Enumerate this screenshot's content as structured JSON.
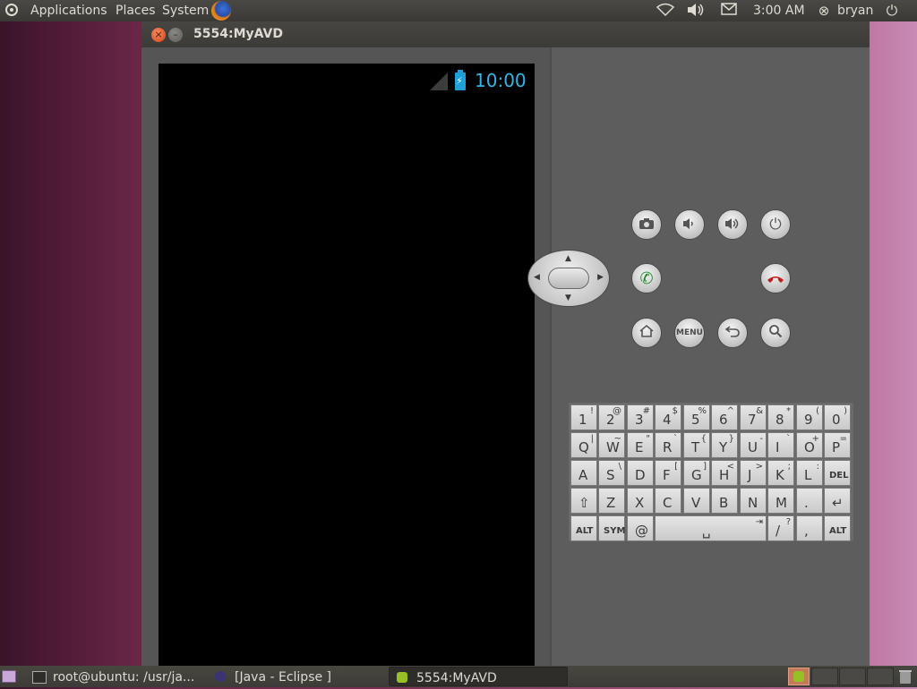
{
  "top_panel": {
    "menus": [
      "Applications",
      "Places",
      "System"
    ],
    "time": "3:00 AM",
    "user": "bryan"
  },
  "window": {
    "title": "5554:MyAVD"
  },
  "phone": {
    "clock": "10:00"
  },
  "controls": {
    "menu_label": "MENU"
  },
  "keyboard": {
    "rows": [
      [
        [
          "1",
          "!"
        ],
        [
          "2",
          "@"
        ],
        [
          "3",
          "#"
        ],
        [
          "4",
          "$"
        ],
        [
          "5",
          "%"
        ],
        [
          "6",
          "^"
        ],
        [
          "7",
          "&"
        ],
        [
          "8",
          "*"
        ],
        [
          "9",
          "("
        ],
        [
          "0",
          ")"
        ]
      ],
      [
        [
          "Q",
          "|"
        ],
        [
          "W",
          "~"
        ],
        [
          "E",
          "\""
        ],
        [
          "R",
          "`"
        ],
        [
          "T",
          "{"
        ],
        [
          "Y",
          "}"
        ],
        [
          "U",
          "-"
        ],
        [
          "I",
          "`"
        ],
        [
          "O",
          "+"
        ],
        [
          "P",
          "="
        ]
      ],
      [
        [
          "A",
          ""
        ],
        [
          "S",
          "\\"
        ],
        [
          "D",
          ""
        ],
        [
          "F",
          "["
        ],
        [
          "G",
          "]"
        ],
        [
          "H",
          "<"
        ],
        [
          "J",
          ">"
        ],
        [
          "K",
          ";"
        ],
        [
          "L",
          ":"
        ],
        [
          "DEL",
          ""
        ]
      ],
      [
        [
          "⇧",
          ""
        ],
        [
          "Z",
          ""
        ],
        [
          "X",
          ""
        ],
        [
          "C",
          ""
        ],
        [
          "V",
          ""
        ],
        [
          "B",
          ""
        ],
        [
          "N",
          ""
        ],
        [
          "M",
          ""
        ],
        [
          ".",
          ""
        ],
        [
          "↵",
          ""
        ]
      ],
      [
        [
          "ALT",
          ""
        ],
        [
          "SYM",
          ""
        ],
        [
          "@",
          ""
        ],
        [
          "␣",
          "⇥"
        ],
        [
          "/",
          "?"
        ],
        [
          ",",
          ""
        ],
        [
          "ALT",
          ""
        ]
      ]
    ]
  },
  "taskbar": {
    "tasks": [
      "root@ubuntu: /usr/ja...",
      "[Java - Eclipse ]",
      "5554:MyAVD"
    ]
  },
  "colors": {
    "clock_blue": "#33b5e5",
    "panel_bg": "#3c3b37",
    "emulator_bg": "#5d5d5d"
  }
}
